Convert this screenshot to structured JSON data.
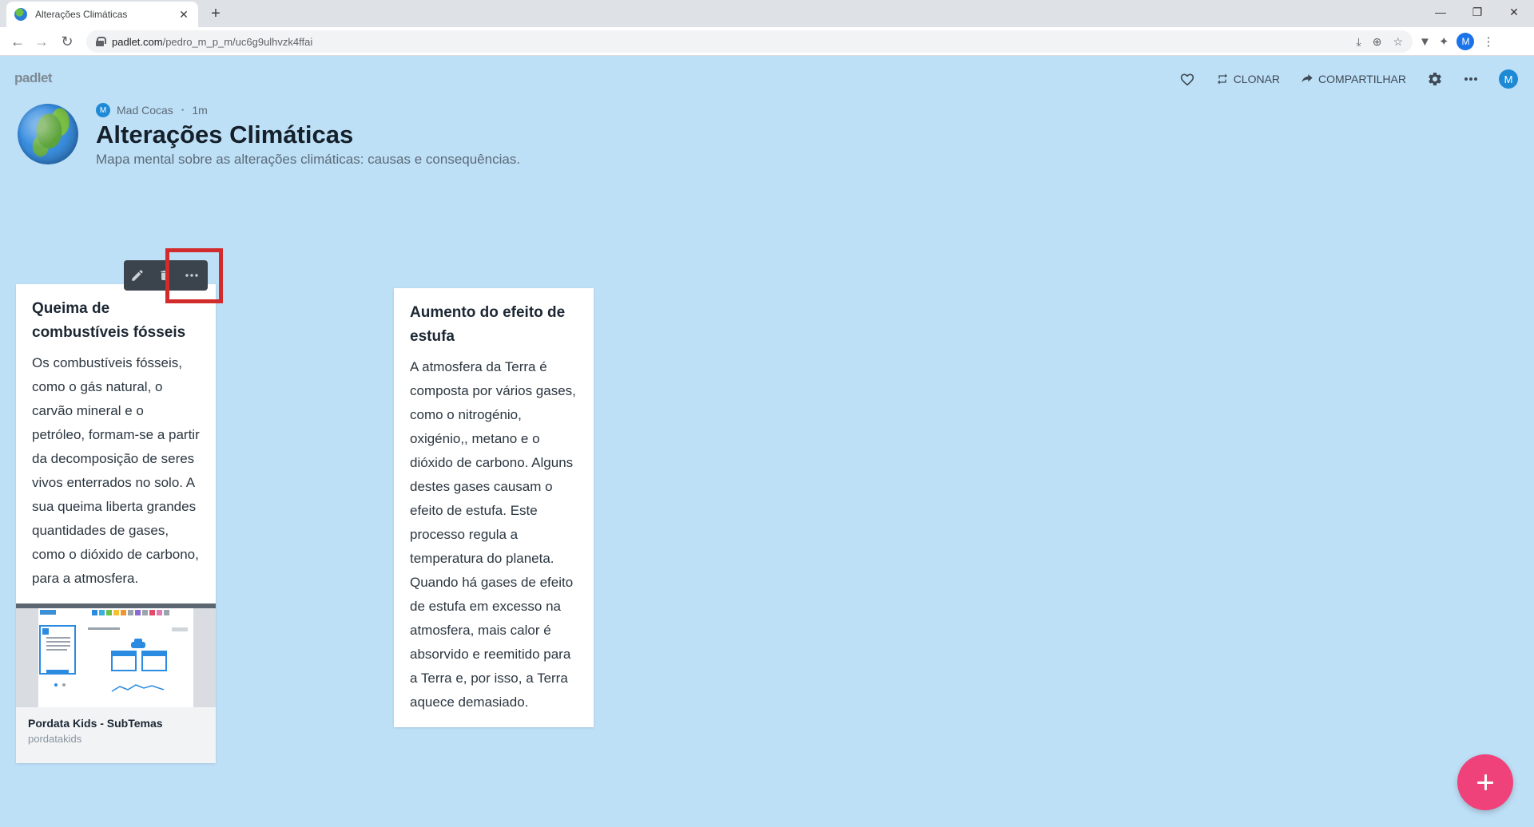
{
  "browser": {
    "tab_title": "Alterações Climáticas",
    "url_host": "padlet.com",
    "url_path": "/pedro_m_p_m/uc6g9ulhvzk4ffai",
    "profile_initial": "M"
  },
  "padlet": {
    "logo": "padlet",
    "toolbar": {
      "clone_label": "CLONAR",
      "share_label": "COMPARTILHAR",
      "avatar_initial": "M"
    },
    "author": {
      "initial": "M",
      "name": "Mad Cocas",
      "time": "1m"
    },
    "title": "Alterações Climáticas",
    "description": "Mapa mental sobre as alterações climáticas: causas e consequências."
  },
  "posts": [
    {
      "title": "Queima de combustíveis fósseis",
      "body": "Os combustíveis fósseis, como o gás natural, o carvão mineral e o petróleo, formam-se a partir da decomposição de seres vivos enterrados no solo. A sua queima liberta grandes quantidades de gases, como o dióxido de carbono, para a atmosfera.",
      "attachment": {
        "title": "Pordata Kids - SubTemas",
        "source": "pordatakids"
      }
    },
    {
      "title": "Aumento do efeito de estufa",
      "body": "A atmosfera da Terra é composta por vários gases, como o nitrogénio, oxigénio,, metano e o dióxido de carbono. Alguns destes gases causam o efeito de estufa. Este processo regula a temperatura do planeta. Quando há gases de efeito de estufa em excesso na atmosfera, mais calor é absorvido e reemitido para a Terra e, por isso, a Terra aquece demasiado."
    }
  ],
  "colors": {
    "background": "#bee0f7",
    "fab": "#f0427a",
    "highlight": "#d22b2b"
  }
}
